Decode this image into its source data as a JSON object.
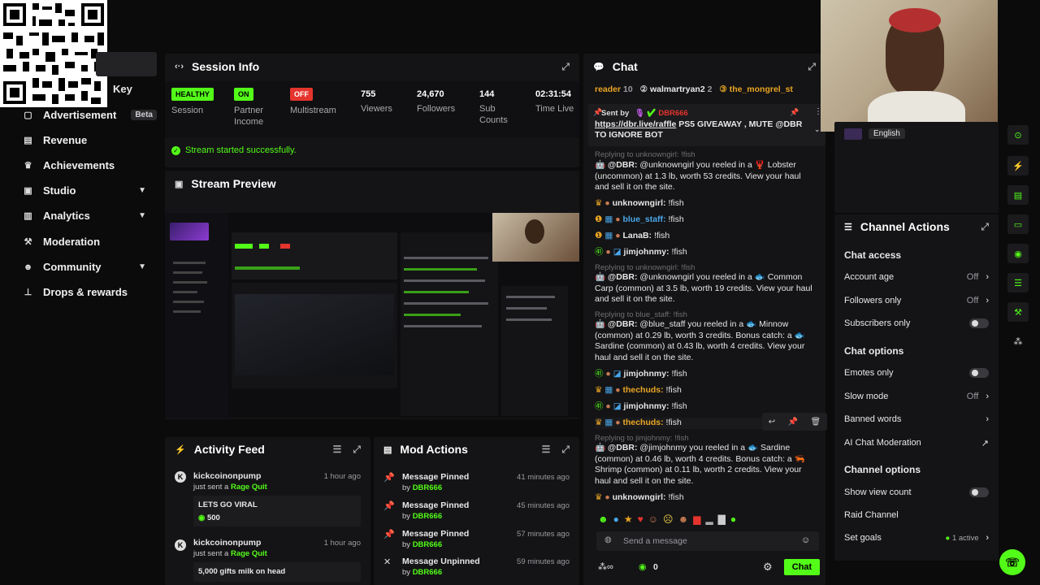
{
  "sidebar": {
    "partial_item": "Key",
    "items": [
      {
        "label": "Advertisement",
        "badge": "Beta",
        "icon": "advertisement-icon"
      },
      {
        "label": "Revenue",
        "icon": "revenue-icon"
      },
      {
        "label": "Achievements",
        "icon": "trophy-icon"
      },
      {
        "label": "Studio",
        "icon": "studio-icon",
        "chevron": true
      },
      {
        "label": "Analytics",
        "icon": "analytics-icon",
        "chevron": true
      },
      {
        "label": "Moderation",
        "icon": "moderation-icon"
      },
      {
        "label": "Community",
        "icon": "community-icon",
        "chevron": true
      },
      {
        "label": "Drops & rewards",
        "icon": "drops-icon"
      }
    ]
  },
  "session": {
    "title": "Session Info",
    "stats": [
      {
        "value": "HEALTHY",
        "label": "Session",
        "kind": "tag-green"
      },
      {
        "value": "ON",
        "label": "Partner Income",
        "kind": "tag-green"
      },
      {
        "value": "OFF",
        "label": "Multistream",
        "kind": "tag-red"
      },
      {
        "value": "755",
        "label": "Viewers"
      },
      {
        "value": "24,670",
        "label": "Followers"
      },
      {
        "value": "144",
        "label": "Sub Counts"
      },
      {
        "value": "02:31:54",
        "label": "Time Live"
      }
    ],
    "success": "Stream started successfully."
  },
  "preview": {
    "title": "Stream Preview"
  },
  "activity": {
    "title": "Activity Feed",
    "items": [
      {
        "user": "kickcoinonpump",
        "action": "just sent a",
        "gift": "Rage Quit",
        "time": "1 hour ago",
        "message": "LETS GO VIRAL",
        "amount": "500"
      },
      {
        "user": "kickcoinonpump",
        "action": "just sent a",
        "gift": "Rage Quit",
        "time": "1 hour ago",
        "message": "5,000 gifts milk on head"
      }
    ]
  },
  "mod": {
    "title": "Mod Actions",
    "items": [
      {
        "action": "Message Pinned",
        "by": "by",
        "user": "DBR666",
        "time": "41 minutes ago"
      },
      {
        "action": "Message Pinned",
        "by": "by",
        "user": "DBR666",
        "time": "45 minutes ago"
      },
      {
        "action": "Message Pinned",
        "by": "by",
        "user": "DBR666",
        "time": "57 minutes ago"
      },
      {
        "action": "Message Unpinned",
        "by": "by",
        "user": "DBR666",
        "time": "59 minutes ago"
      }
    ]
  },
  "chat": {
    "title": "Chat",
    "top_users": [
      {
        "name": "reader",
        "count": "10"
      },
      {
        "name": "walmartryan2",
        "count": "2"
      },
      {
        "name": "the_mongrel_st"
      }
    ],
    "pinned": {
      "sent_by": "Sent by",
      "sender": "DBR666",
      "link": "https://dbr.live/raffle",
      "text": "PS5 GIVEAWAY , MUTE @DBR TO IGNORE BOT"
    },
    "reply_1": "Replying to unknowngirl: !fish",
    "msg_1": {
      "mention": "@DBR:",
      "text": "@unknowngirl you reeled in a 🦞 Lobster (uncommon) at 1.3 lb, worth 53 credits. View your haul and sell it on the site."
    },
    "line_unknowngirl_1": {
      "user": "unknowngirl:",
      "text": "!fish"
    },
    "line_blue_staff": {
      "user": "blue_staff:",
      "text": "!fish"
    },
    "line_lanab": {
      "user": "LanaB:",
      "text": "!fish"
    },
    "line_jimjohnmy_1": {
      "user": "jimjohnmy:",
      "text": "!fish"
    },
    "reply_2": "Replying to unknowngirl: !fish",
    "msg_2": {
      "mention": "@DBR:",
      "text": "@unknowngirl you reeled in a 🐟 Common Carp (common) at 3.5 lb, worth 19 credits. View your haul and sell it on the site."
    },
    "reply_3": "Replying to blue_staff: !fish",
    "msg_3": {
      "mention": "@DBR:",
      "text": "@blue_staff you reeled in a 🐟 Minnow (common) at 0.29 lb, worth 3 credits. Bonus catch: a 🐟 Sardine (common) at 0.43 lb, worth 4 credits. View your haul and sell it on the site."
    },
    "line_jimjohnmy_2": {
      "user": "jimjohnmy:",
      "text": "!fish"
    },
    "line_thechuds_1": {
      "user": "thechuds:",
      "text": "!fish"
    },
    "line_jimjohnmy_3": {
      "user": "jimjohnmy:",
      "text": "!fish"
    },
    "line_thechuds_2": {
      "user": "thechuds:",
      "text": "!fish"
    },
    "reply_4": "Replying to jimjohnmy: !fish",
    "msg_4": {
      "mention": "@DBR:",
      "text": "@jimjohnmy you reeled in a 🐟 Sardine (common) at 0.46 lb, worth 4 credits. Bonus catch: a 🦐 Shrimp (common) at 0.11 lb, worth 2 credits. View your haul and sell it on the site."
    },
    "line_unknowngirl_2": {
      "user": "unknowngirl:",
      "text": "!fish"
    },
    "input_placeholder": "Send a message",
    "count": "0",
    "send_label": "Chat"
  },
  "webcam": {
    "language": "English"
  },
  "channel_actions": {
    "title": "Channel Actions",
    "chat_access": "Chat access",
    "account_age": {
      "label": "Account age",
      "value": "Off"
    },
    "followers_only": {
      "label": "Followers only",
      "value": "Off"
    },
    "subscribers_only": {
      "label": "Subscribers only"
    },
    "chat_options": "Chat options",
    "emotes_only": {
      "label": "Emotes only"
    },
    "slow_mode": {
      "label": "Slow mode",
      "value": "Off"
    },
    "banned_words": {
      "label": "Banned words"
    },
    "ai_moderation": {
      "label": "AI Chat Moderation"
    },
    "channel_options": "Channel options",
    "show_view_count": {
      "label": "Show view count"
    },
    "raid_channel": {
      "label": "Raid Channel"
    },
    "set_goals": {
      "label": "Set goals",
      "value": "1 active"
    }
  },
  "colors": {
    "accent": "#53fc18",
    "background": "#0b0b0c",
    "panel": "#141416",
    "danger": "#e5342d"
  }
}
